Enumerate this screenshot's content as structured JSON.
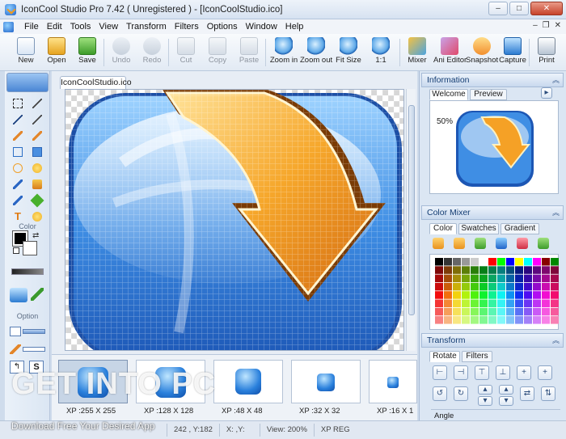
{
  "window": {
    "title": "IconCool Studio Pro 7.42 ( Unregistered ) - [IconCoolStudio.ico]",
    "min_label": "–",
    "max_label": "□",
    "close_label": "✕"
  },
  "menu": {
    "items": [
      "File",
      "Edit",
      "Tools",
      "View",
      "Transform",
      "Filters",
      "Options",
      "Window",
      "Help"
    ],
    "mdi": [
      "–",
      "❐",
      "✕"
    ]
  },
  "toolbar": {
    "buttons": [
      {
        "label": "New",
        "icon": "new-icon",
        "enabled": true
      },
      {
        "label": "Open",
        "icon": "open-folder-icon",
        "enabled": true
      },
      {
        "label": "Save",
        "icon": "save-icon",
        "enabled": true
      },
      {
        "label": "Undo",
        "icon": "undo-icon",
        "enabled": false
      },
      {
        "label": "Redo",
        "icon": "redo-icon",
        "enabled": false
      },
      {
        "label": "Cut",
        "icon": "cut-icon",
        "enabled": false
      },
      {
        "label": "Copy",
        "icon": "copy-icon",
        "enabled": false
      },
      {
        "label": "Paste",
        "icon": "paste-icon",
        "enabled": false
      },
      {
        "label": "Zoom in",
        "icon": "zoom-in-icon",
        "enabled": true
      },
      {
        "label": "Zoom out",
        "icon": "zoom-out-icon",
        "enabled": true
      },
      {
        "label": "Fit Size",
        "icon": "fit-size-icon",
        "enabled": true
      },
      {
        "label": "1:1",
        "icon": "actual-size-icon",
        "enabled": true
      },
      {
        "label": "Mixer",
        "icon": "mixer-icon",
        "enabled": true
      },
      {
        "label": "Ani Editor",
        "icon": "ani-editor-icon",
        "enabled": true
      },
      {
        "label": "Snapshot",
        "icon": "snapshot-icon",
        "enabled": true
      },
      {
        "label": "Capture",
        "icon": "capture-icon",
        "enabled": true
      },
      {
        "label": "Print",
        "icon": "print-icon",
        "enabled": true
      }
    ]
  },
  "lefttools": {
    "color_label": "Color",
    "option_label": "Option"
  },
  "document": {
    "tab": "IconCoolStudio.ico"
  },
  "filmstrip": {
    "thumbs": [
      {
        "label": "XP :255 X 255",
        "selected": true
      },
      {
        "label": "XP :128 X 128",
        "selected": false
      },
      {
        "label": "XP :48 X 48",
        "selected": false
      },
      {
        "label": "XP :32 X 32",
        "selected": false
      },
      {
        "label": "XP :16 X 1",
        "selected": false
      }
    ]
  },
  "status": {
    "coords": "242 , Y:182",
    "xy": "X: ,Y:",
    "view": "View: 200%",
    "mode": "XP REG"
  },
  "info": {
    "title": "Information",
    "tabs": [
      "Welcome",
      "Preview"
    ],
    "zoom": "50%"
  },
  "mixer": {
    "title": "Color Mixer",
    "tabs": [
      "Color",
      "Swatches",
      "Gradient"
    ]
  },
  "transform": {
    "title": "Transform",
    "tabs": [
      "Rotate",
      "Filters"
    ],
    "angle_label": "Angle"
  },
  "watermark": {
    "main_a": "GET ",
    "main_b": "INTO ",
    "main_c": "PC",
    "sub": "Download Free Your Desired App"
  }
}
